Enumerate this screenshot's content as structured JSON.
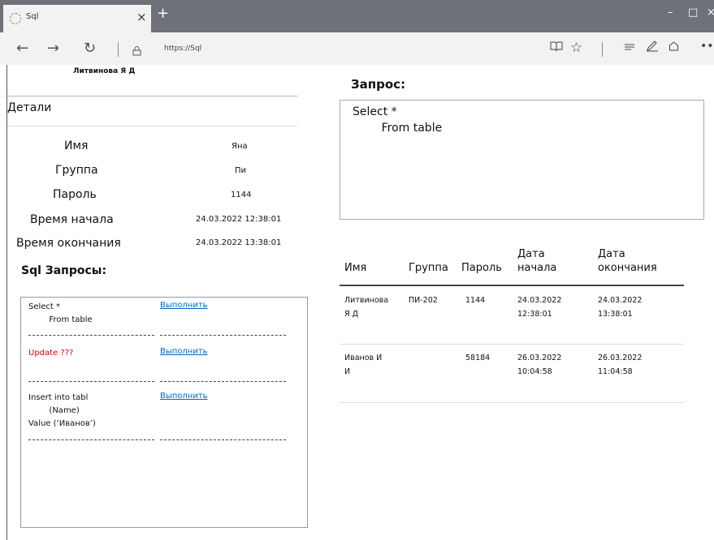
{
  "browser": {
    "tab_title": "Sql",
    "tab_close": "×",
    "new_tab": "+",
    "window_min": "–",
    "window_max": "□",
    "window_close": "×",
    "back": "←",
    "forward": "→",
    "refresh": "↻",
    "url": "https://Sql",
    "icons": [
      "reading-view-icon",
      "favorite-star-icon",
      "hub-icon",
      "notes-icon",
      "share-icon",
      "more-icon"
    ]
  },
  "user_name": "Литвинова Я Д",
  "details": {
    "heading": "Детали",
    "rows": [
      {
        "label": "Имя",
        "value": "Яна"
      },
      {
        "label": "Группа",
        "value": "Пи"
      },
      {
        "label": "Пароль",
        "value": "1144"
      },
      {
        "label": "Время начала",
        "value": "24.03.2022 12:38:01"
      },
      {
        "label": "Время окончания",
        "value": "24.03.2022 13:38:01"
      }
    ]
  },
  "sql": {
    "heading": "Sql Запросы:",
    "queries": [
      {
        "text": "Select *\n        From table",
        "run_label": "Выполнить",
        "color": "#111111"
      },
      {
        "text": "Update ???",
        "run_label": "Выполнить",
        "color": "#e00000"
      },
      {
        "text": "Insert into tabl\n        (Name)\nValue (‘Иванов’)",
        "run_label": "Выполнить",
        "color": "#111111"
      }
    ]
  },
  "request": {
    "heading": "Запрос:",
    "line1": "Select *",
    "line2": "        From table"
  },
  "table": {
    "headers": [
      "Имя",
      "Группа",
      "Пароль",
      "Дата\nначала",
      "Дата\nокончания"
    ],
    "rows": [
      [
        "Литвинова\nЯ Д",
        "ПИ-202",
        "1144",
        "24.03.2022\n12:38:01",
        "24.03.2022\n13:38:01"
      ],
      [
        "Иванов И\nИ",
        "",
        "58184",
        "26.03.2022\n10:04:58",
        "26.03.2022\n11:04:58"
      ]
    ]
  },
  "colors": {
    "link": "#0563c1",
    "error": "#e00000",
    "tabbar": "#6e7178"
  }
}
